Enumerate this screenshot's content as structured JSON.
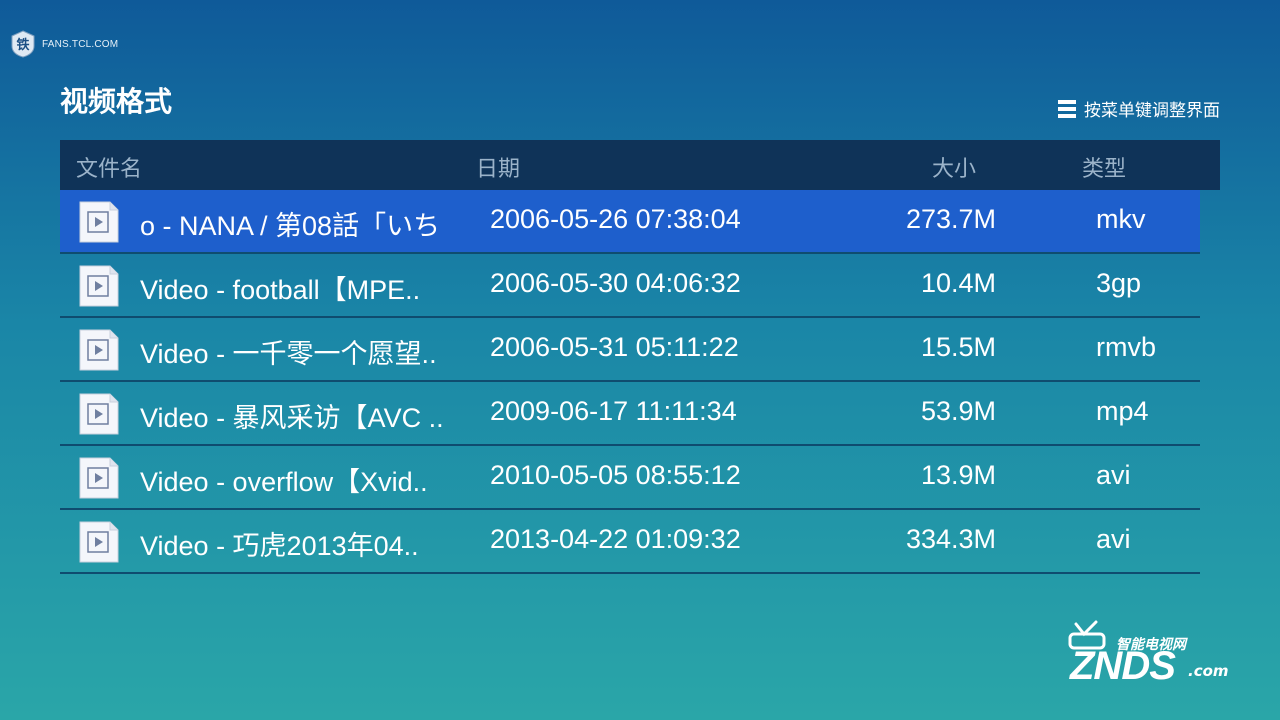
{
  "watermark": {
    "site": "FANS.TCL.COM",
    "logo_char": "铁"
  },
  "header": {
    "title": "视频格式",
    "menu_hint": "按菜单键调整界面"
  },
  "table": {
    "columns": [
      "文件名",
      "日期",
      "大小",
      "类型"
    ],
    "rows": [
      {
        "name": "o - NANA / 第08話「いち",
        "date": "2006-05-26 07:38:04",
        "size": "273.7M",
        "type": "mkv",
        "selected": true
      },
      {
        "name": "Video - football【MPE..",
        "date": "2006-05-30 04:06:32",
        "size": "10.4M",
        "type": "3gp"
      },
      {
        "name": "Video - 一千零一个愿望..",
        "date": "2006-05-31 05:11:22",
        "size": "15.5M",
        "type": "rmvb"
      },
      {
        "name": "Video - 暴风采访【AVC ..",
        "date": "2009-06-17 11:11:34",
        "size": "53.9M",
        "type": "mp4"
      },
      {
        "name": "Video - overflow【Xvid..",
        "date": "2010-05-05 08:55:12",
        "size": "13.9M",
        "type": "avi"
      },
      {
        "name": "Video - 巧虎2013年04..",
        "date": "2013-04-22 01:09:32",
        "size": "334.3M",
        "type": "avi"
      }
    ]
  },
  "znds": {
    "tagline": "智能电视网",
    "brand": "ZNDS",
    "suffix": ".com"
  },
  "icons": {
    "file": "video-file-icon",
    "menu": "menu-icon"
  },
  "colors": {
    "selected_row": "#1e5fcc",
    "header_bg": "#0f3358",
    "divider": "#0f4c6f"
  }
}
